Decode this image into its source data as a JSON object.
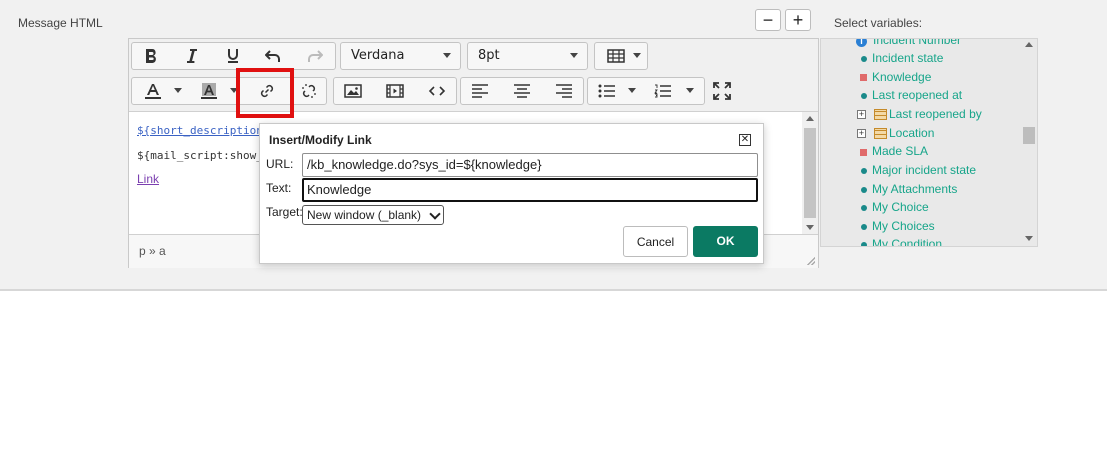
{
  "field": {
    "label": "Message HTML"
  },
  "zoom": {
    "minus": "−",
    "plus": "+"
  },
  "vars_label": "Select variables:",
  "toolbar": {
    "font_family": "Verdana",
    "font_size": "8pt"
  },
  "content": {
    "line1": "${short_description}",
    "line2": "${mail_script:show_la",
    "line3": "Link"
  },
  "statusbar": {
    "path": "p » a"
  },
  "dialog": {
    "title": "Insert/Modify Link",
    "close": "✕",
    "url_label": "URL:",
    "url_value": "/kb_knowledge.do?sys_id=${knowledge}",
    "text_label": "Text:",
    "text_value": "Knowledge",
    "target_label": "Target:",
    "target_value": "New window (_blank)",
    "cancel": "Cancel",
    "ok": "OK"
  },
  "variables": [
    {
      "label": "Incident Number",
      "icon": "info-icon"
    },
    {
      "label": "Incident state",
      "icon": "dot-icon"
    },
    {
      "label": "Knowledge",
      "icon": "square-icon"
    },
    {
      "label": "Last reopened at",
      "icon": "dot-icon"
    },
    {
      "label": "Last reopened by",
      "icon": "table-icon"
    },
    {
      "label": "Location",
      "icon": "table-icon"
    },
    {
      "label": "Made SLA",
      "icon": "square-icon"
    },
    {
      "label": "Major incident state",
      "icon": "dot-icon"
    },
    {
      "label": "My Attachments",
      "icon": "dot-icon"
    },
    {
      "label": "My Choice",
      "icon": "dot-icon"
    },
    {
      "label": "My Choices",
      "icon": "dot-icon"
    },
    {
      "label": "My Condition",
      "icon": "dot-icon"
    }
  ],
  "colors": {
    "accent": "#0b7a63",
    "variable_text": "#17a58a",
    "highlight": "#e01010"
  }
}
